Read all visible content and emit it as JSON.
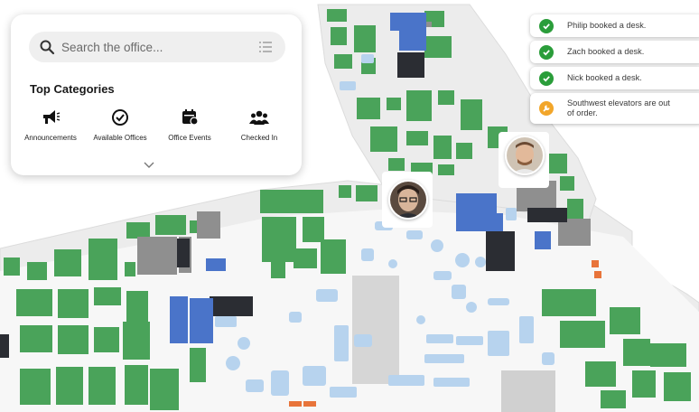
{
  "search": {
    "placeholder": "Search the office..."
  },
  "categories_panel": {
    "title": "Top Categories",
    "items": [
      {
        "label": "Announcements",
        "icon": "megaphone-icon"
      },
      {
        "label": "Available Offices",
        "icon": "check-circle-icon"
      },
      {
        "label": "Office Events",
        "icon": "calendar-icon"
      },
      {
        "label": "Checked In",
        "icon": "people-icon"
      }
    ]
  },
  "notifications": [
    {
      "text": "Philip booked a desk.",
      "type": "success"
    },
    {
      "text": "Zach booked a desk.",
      "type": "success"
    },
    {
      "text": "Nick booked a desk.",
      "type": "success"
    },
    {
      "text_line1": "Southwest elevators are out",
      "text_line2": "of order.",
      "type": "warning"
    }
  ],
  "colors": {
    "success": "#2a9d3a",
    "warning": "#f2a62a",
    "room_green": "#4aa35a",
    "room_blue": "#4a74c9",
    "room_dark": "#2b2d33",
    "room_gray": "#9a9a9a",
    "floor": "#efefef",
    "furniture": "#b7d3ee"
  }
}
